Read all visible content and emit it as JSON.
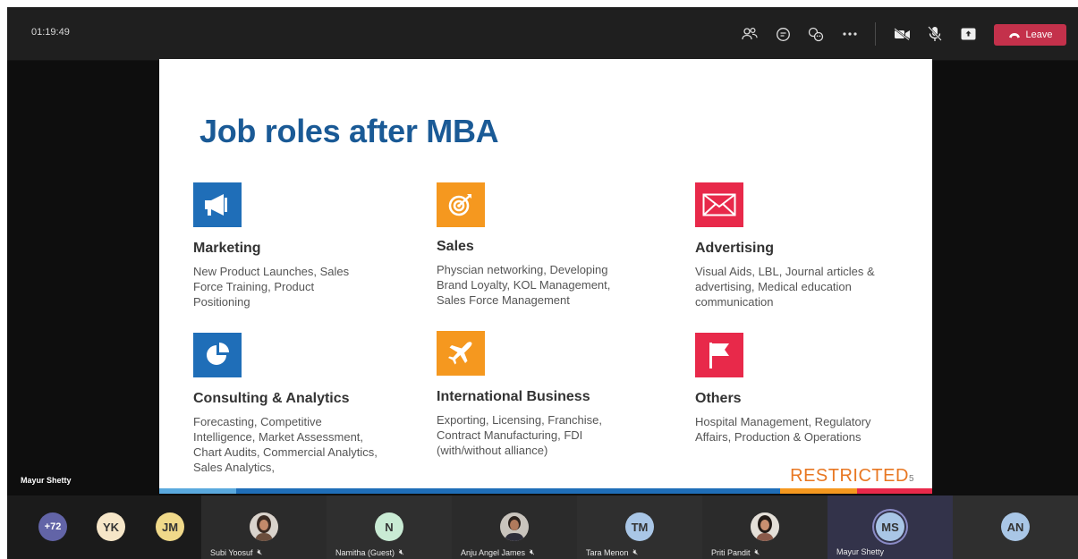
{
  "meeting": {
    "elapsed_time": "01:19:49",
    "leave_label": "Leave",
    "presenter_name": "Mayur Shetty"
  },
  "toolbar": {
    "icons": [
      "participants-icon",
      "chat-icon",
      "reactions-icon",
      "more-icon",
      "camera-off-icon",
      "mic-off-icon",
      "share-icon"
    ]
  },
  "slide": {
    "title": "Job roles after MBA",
    "footer_label": "RESTRICTED",
    "page_number": "5",
    "roles": [
      {
        "heading": "Marketing",
        "description": "New Product Launches, Sales Force Training, Product Positioning",
        "color": "#1f6eb8",
        "icon": "megaphone-icon"
      },
      {
        "heading": "Sales",
        "description": "Physcian networking, Developing Brand Loyalty, KOL Management, Sales Force Management",
        "color": "#f5981f",
        "icon": "target-icon"
      },
      {
        "heading": "Advertising",
        "description": "Visual Aids, LBL, Journal articles & advertising, Medical education communication",
        "color": "#e8294a",
        "icon": "envelope-icon"
      },
      {
        "heading": "Consulting & Analytics",
        "description": "Forecasting, Competitive Intelligence, Market Assessment, Chart Audits, Commercial Analytics, Sales Analytics,",
        "color": "#1f6eb8",
        "icon": "pie-chart-icon"
      },
      {
        "heading": "International Business",
        "description": "Exporting, Licensing, Franchise, Contract Manufacturing, FDI (with/without alliance)",
        "color": "#f5981f",
        "icon": "airplane-icon"
      },
      {
        "heading": "Others",
        "description": "Hospital Management, Regulatory Affairs,  Production & Operations",
        "color": "#e8294a",
        "icon": "flag-icon"
      }
    ]
  },
  "participants": {
    "overflow_count": "+72",
    "initials_only": [
      {
        "initials": "YK",
        "color": "#f6e6c8"
      },
      {
        "initials": "JM",
        "color": "#f0d98a"
      }
    ],
    "tiles": [
      {
        "name": "Subi Yoosuf",
        "initials": "",
        "avatar": "photo"
      },
      {
        "name": "Namitha (Guest)",
        "initials": "N",
        "avatar": "#c9ebd4"
      },
      {
        "name": "Anju Angel James",
        "initials": "",
        "avatar": "photo"
      },
      {
        "name": "Tara Menon",
        "initials": "TM",
        "avatar": "#a9c6e6"
      },
      {
        "name": "Priti Pandit",
        "initials": "",
        "avatar": "photo"
      },
      {
        "name": "Mayur Shetty",
        "initials": "MS",
        "avatar": "#a9c6e6"
      },
      {
        "name": "",
        "initials": "AN",
        "avatar": "#a9c6e6"
      }
    ]
  }
}
